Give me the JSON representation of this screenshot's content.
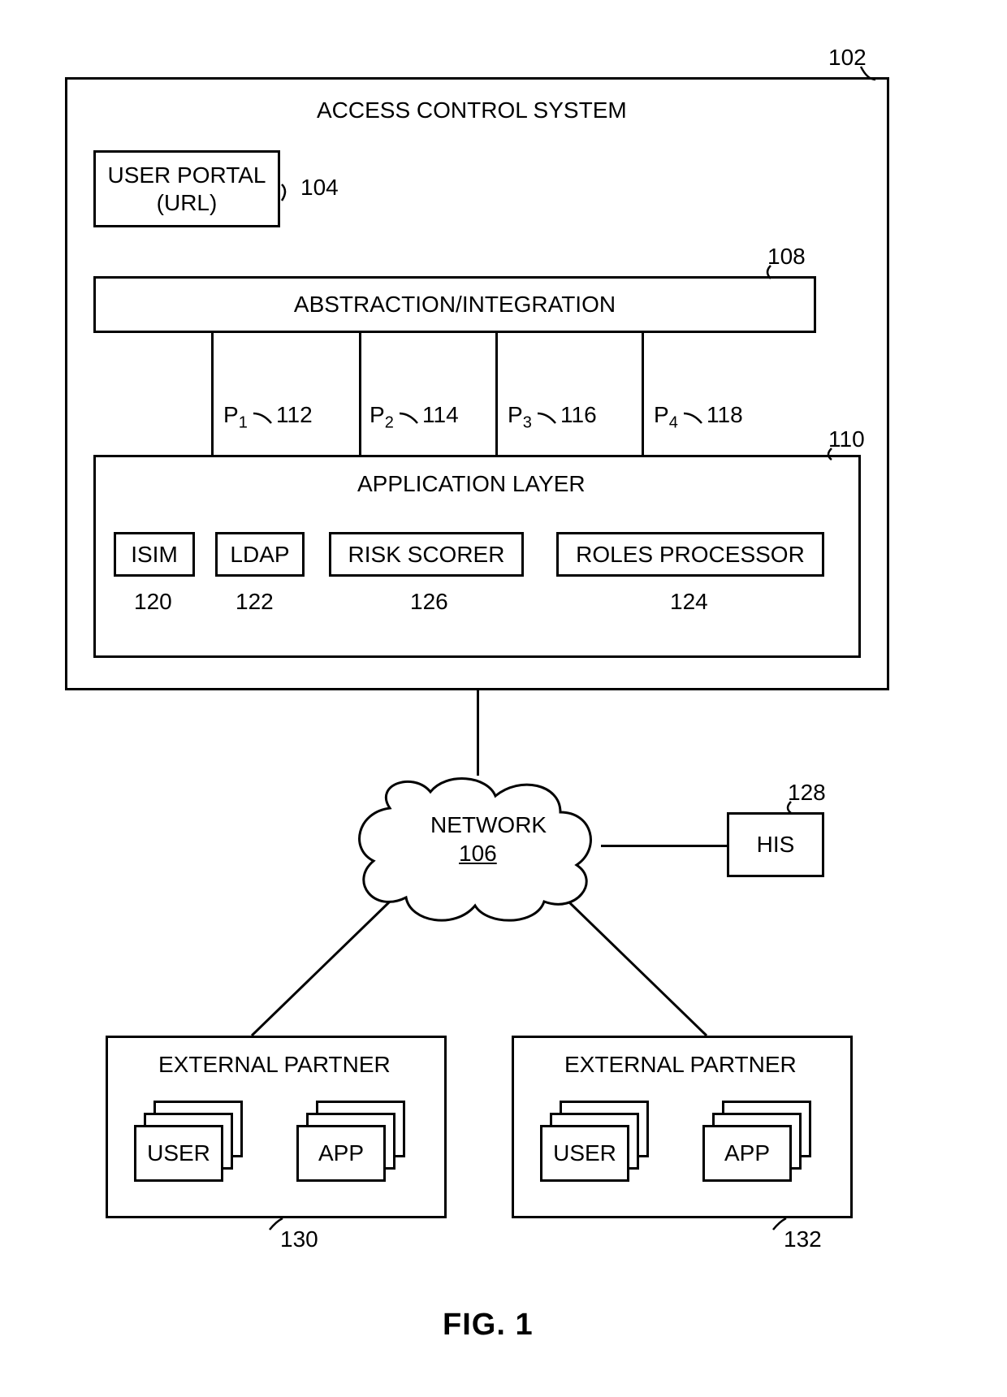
{
  "refs": {
    "sys": "102",
    "portal": "104",
    "network": "106",
    "abstraction": "108",
    "applayer": "110",
    "p1": "112",
    "p2": "114",
    "p3": "116",
    "p4": "118",
    "isim": "120",
    "ldap": "122",
    "roles": "124",
    "risk": "126",
    "his": "128",
    "partner_left": "130",
    "partner_right": "132"
  },
  "labels": {
    "sys_title": "ACCESS CONTROL SYSTEM",
    "portal_line1": "USER PORTAL",
    "portal_line2": "(URL)",
    "abstraction": "ABSTRACTION/INTEGRATION",
    "p1": "P",
    "p2": "P",
    "p3": "P",
    "p4": "P",
    "p1s": "1",
    "p2s": "2",
    "p3s": "3",
    "p4s": "4",
    "applayer": "APPLICATION LAYER",
    "isim": "ISIM",
    "ldap": "LDAP",
    "risk": "RISK SCORER",
    "roles": "ROLES PROCESSOR",
    "network": "NETWORK",
    "his": "HIS",
    "partner": "EXTERNAL PARTNER",
    "user": "USER",
    "app": "APP",
    "fig": "FIG. 1"
  }
}
